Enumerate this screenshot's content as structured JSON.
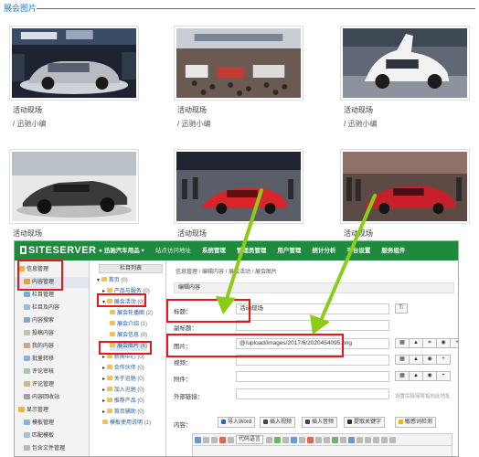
{
  "gallery": {
    "title": "展会图片",
    "items": [
      {
        "caption": "活动现场",
        "author": "/ 迅驰小编"
      },
      {
        "caption": "活动现场",
        "author": "/ 迅驰小编"
      },
      {
        "caption": "活动现场",
        "author": "/ 迅驰小编"
      },
      {
        "caption": "活动现场",
        "author": ""
      },
      {
        "caption": "活动现场",
        "author": ""
      },
      {
        "caption": "活动现场",
        "author": ""
      }
    ]
  },
  "cms": {
    "logo": "SITESERVER",
    "site": "迅驰汽车用品",
    "nav": [
      "站点访问地址",
      "系统管理",
      "管理员管理",
      "用户管理",
      "统计分析",
      "平台设置",
      "服务组件"
    ],
    "sidebar": [
      "信息管理",
      "内容管理",
      "栏目管理",
      "栏目及内容",
      "内容搜索",
      "投稿内容",
      "我的内容",
      "批量转移",
      "评论审核",
      "评论管理",
      "内容回收站",
      "显示管理",
      "模板管理",
      "匹配模板",
      "包含文件管理"
    ],
    "tree_title": "栏目列表",
    "tree": [
      {
        "label": "首页",
        "count": "(0)"
      },
      {
        "label": "产品与服务",
        "count": "(0)"
      },
      {
        "label": "展会活动",
        "count": "(0)"
      },
      {
        "label": "展会轮播图",
        "count": "(2)"
      },
      {
        "label": "展会介绍",
        "count": "(1)"
      },
      {
        "label": "展会信息",
        "count": "(0)"
      },
      {
        "label": "展会图片",
        "count": "(6)"
      },
      {
        "label": "新闻中心",
        "count": "(0)"
      },
      {
        "label": "合作伙伴",
        "count": "(0)"
      },
      {
        "label": "关于迅驰",
        "count": "(0)"
      },
      {
        "label": "加入迅驰",
        "count": "(0)"
      },
      {
        "label": "推荐产品",
        "count": "(0)"
      },
      {
        "label": "首页辅助",
        "count": "(0)"
      },
      {
        "label": "模板使用说明",
        "count": "(1)"
      }
    ],
    "breadcrumb": "信息管理 / 编辑内容 / 展会活动 / 展会图片",
    "edit_title": "编辑内容",
    "form": {
      "title_label": "标题：",
      "title_value": "活动现场",
      "subtitle_label": "副标题：",
      "image_label": "图片：",
      "image_value": "@/upload/images/2017/6/2020454095.png",
      "video_label": "视频：",
      "attach_label": "附件：",
      "link_label": "外部链接：",
      "link_hint": "设置后链接将指向此地址",
      "content_label": "内容："
    },
    "tools": [
      "导入Word",
      "插入视频",
      "插入音频",
      "提取关键字",
      "敏感词检测"
    ],
    "rich_select": "代码语言"
  }
}
